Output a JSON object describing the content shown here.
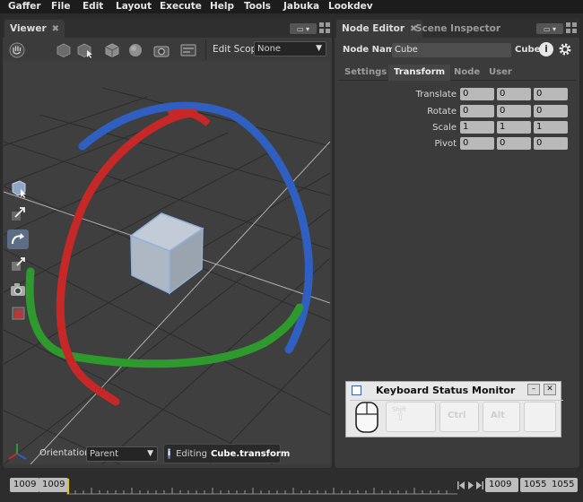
{
  "menu": [
    "Gaffer",
    "File",
    "Edit",
    "Layout",
    "Execute",
    "Help",
    "Tools",
    "Jabuka",
    "Lookdev"
  ],
  "viewer": {
    "tab_label": "Viewer",
    "tab_close": "✖",
    "edit_scope_label": "Edit Scope",
    "edit_scope_value": "None",
    "orientation_label": "Orientation",
    "orientation_value": "Parent",
    "editing_prefix": "Editing",
    "editing_target": "Cube.transform",
    "info_glyph": "i"
  },
  "node_editor": {
    "tabs": [
      {
        "label": "Node Editor",
        "close": "✖"
      },
      {
        "label": "Scene Inspector"
      }
    ],
    "node_name_label": "Node Name",
    "node_name_value": "Cube",
    "node_type": "Cube",
    "subtabs": [
      "Settings",
      "Transform",
      "Node",
      "User"
    ],
    "active_subtab": "Transform",
    "rows": [
      {
        "label": "Translate",
        "values": [
          "0",
          "0",
          "0"
        ]
      },
      {
        "label": "Rotate",
        "values": [
          "0",
          "0",
          "0"
        ]
      },
      {
        "label": "Scale",
        "values": [
          "1",
          "1",
          "1"
        ]
      },
      {
        "label": "Pivot",
        "values": [
          "0",
          "0",
          "0"
        ]
      }
    ]
  },
  "keyboard_monitor": {
    "title": "Keyboard Status Monitor",
    "keys": [
      "Shift",
      "Ctrl",
      "Alt",
      ""
    ]
  },
  "timeline": {
    "start_outer": "1009",
    "start_inner": "1009",
    "current": "1009",
    "end_inner": "1055",
    "end_outer": "1055"
  },
  "colors": {
    "rotate_x": "#c62828",
    "rotate_y": "#2e9a2e",
    "rotate_z": "#2f5fc0",
    "tool_selected": "#5c6e85",
    "playhead": "#e8c800"
  }
}
